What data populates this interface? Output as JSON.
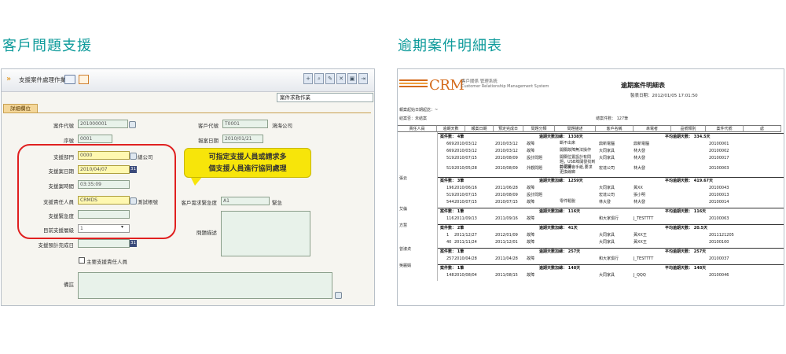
{
  "headings": {
    "left": "客戶問題支援",
    "right": "逾期案件明細表"
  },
  "left": {
    "window_title": "支援案件處理作業",
    "case_label": "案件求救作業",
    "tab": "詳細欄位",
    "fields": {
      "case_no_label": "案件代號",
      "case_no": "201000001",
      "customer_code_label": "客戶代號",
      "customer_code": "T0001",
      "customer_name": "鴻海公司",
      "serial_label": "序號",
      "serial": "0001",
      "report_date_label": "報案日期",
      "report_date": "2010/01/21",
      "support_dept_label": "支援部門",
      "support_dept": "0000",
      "support_dept_name": "總公司",
      "support_date_label": "支援案日期",
      "support_date": "2010/04/07",
      "support_time_label": "支援案時間",
      "support_time": "03:35:09",
      "support_person_label": "支援責任人員",
      "support_person": "CRMDS",
      "support_person_name": "測試帳號",
      "urgency_label": "支援緊急度",
      "customer_urgency_label": "客戶需求緊急度",
      "customer_urgency": "A1",
      "customer_urgency_name": "緊急",
      "level_label": "目前支援層級",
      "level": "1",
      "issue_desc_label": "問題描述",
      "est_finish_label": "支援預計完成日",
      "main_person_label": "主要支援責任人員",
      "note_label": "備註"
    },
    "callout": [
      "可指定支援人員或請求多",
      "個支援人員進行協同處理"
    ],
    "cal_glyph": "31"
  },
  "right": {
    "logo": "CRM",
    "logo_sub1": "客戶關係 管理系統",
    "logo_sub2": "Customer Relationship Management System",
    "title": "逾期案件明細表",
    "print_date": "製表日期：2012/01/05 17:01:50",
    "meta1": "報案起始日期起訖：~",
    "meta2": "結案否：未結案",
    "total": "總案件數：  127筆",
    "columns": [
      "責任人員",
      "逾期天數",
      "報案日期",
      "預定完成日",
      "問題分類",
      "問題描述",
      "客戶名稱",
      "來電者",
      "品號類別",
      "案件代號",
      "處"
    ],
    "groups": [
      {
        "person": "",
        "summary": [
          "案件數：  4筆",
          "逾期天數加總：  1338天",
          "平均逾期天數：  334.5天"
        ],
        "rows": [
          [
            "669",
            "2010/03/12",
            "2010/03/12",
            "故障",
            "斷不出來",
            "鼎新電腦",
            "鼎新電腦",
            "",
            "20100001"
          ],
          [
            "669",
            "2010/03/12",
            "2010/03/12",
            "故障",
            "開關故障無法操作",
            "大同家具",
            "林大發",
            "",
            "20100002"
          ],
          [
            "519",
            "2010/07/15",
            "2010/08/09",
            "設計問題",
            "開關位置設計有問題，USB埠開發找到此建議",
            "大同家具",
            "林大發",
            "",
            "20100017"
          ],
          [
            "519",
            "2010/05/28",
            "2010/08/09",
            "外觀問題",
            "彰化縣會手紙,要求更換線廊",
            "宏達公司",
            "林大發",
            "",
            "20100003"
          ]
        ]
      },
      {
        "person": "張云",
        "summary": [
          "案件數：  3筆",
          "逾期天數加總：  1259天",
          "平均逾期天數：  419.67天"
        ],
        "rows": [
          [
            "196",
            "2010/06/16",
            "2011/06/28",
            "故障",
            "",
            "大同家具",
            "黃XX",
            "",
            "20100043"
          ],
          [
            "519",
            "2010/07/15",
            "2010/08/09",
            "設計問題",
            "",
            "宏達公司",
            "張小明",
            "",
            "20100013"
          ],
          [
            "544",
            "2010/07/15",
            "2010/07/15",
            "故障",
            "零件鬆脫",
            "林大發",
            "林大發",
            "",
            "20100014"
          ]
        ]
      },
      {
        "person": "艾倫",
        "summary": [
          "案件數：  1筆",
          "逾期天數加總：  116天",
          "平均逾期天數：  116天"
        ],
        "rows": [
          [
            "116",
            "2011/09/13",
            "2011/09/16",
            "故障",
            "",
            "和大家俱行",
            "J_TESTTTT",
            "",
            "20100063"
          ]
        ]
      },
      {
        "person": "方慧",
        "summary": [
          "案件數：  2筆",
          "逾期天數加總：  41天",
          "平均逾期天數：  20.5天"
        ],
        "rows": [
          [
            "1",
            "2011/12/27",
            "2012/01/09",
            "故障",
            "",
            "大同家具",
            "黃XX王",
            "",
            "2011121205"
          ],
          [
            "40",
            "2011/11/24",
            "2011/12/01",
            "故障",
            "",
            "大同家具",
            "黃XX王",
            "",
            "20100100"
          ]
        ]
      },
      {
        "person": "曾淑貞",
        "summary": [
          "案件數：  1筆",
          "逾期天數加總：  257天",
          "平均逾期天數：  257天"
        ],
        "rows": [
          [
            "257",
            "2010/04/28",
            "2011/04/28",
            "故障",
            "",
            "和大家俱行",
            "J_TESTTTT",
            "",
            "20100037"
          ]
        ]
      },
      {
        "person": "吳麗娟",
        "summary": [
          "案件數：  1筆",
          "逾期天數加總：  148天",
          "平均逾期天數：  148天"
        ],
        "rows": [
          [
            "148",
            "2010/08/04",
            "2011/08/15",
            "故障",
            "",
            "大同家具",
            "J_QQQ",
            "",
            "20100046"
          ]
        ]
      }
    ]
  }
}
